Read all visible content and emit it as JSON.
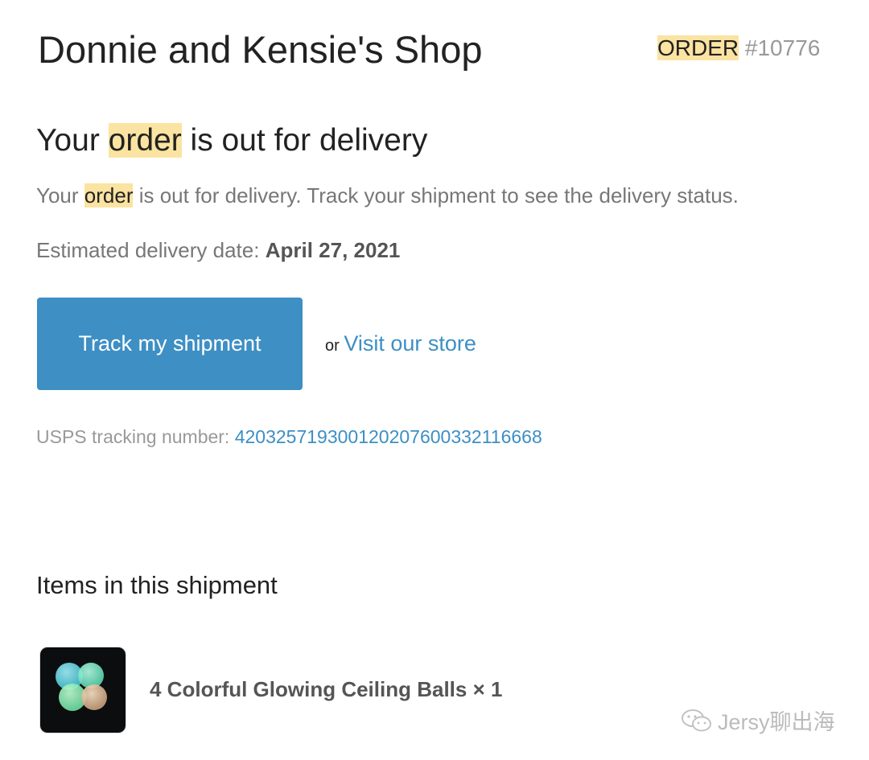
{
  "header": {
    "shop_name": "Donnie and Kensie's Shop",
    "order_word": "ORDER",
    "order_number": "#10776"
  },
  "status": {
    "heading_prefix": "Your",
    "heading_highlight": "order",
    "heading_suffix": "is out for delivery",
    "body_prefix": "Your",
    "body_highlight": "order",
    "body_suffix": "is out for delivery. Track your shipment to see the delivery status.",
    "estimated_label": "Estimated delivery date:",
    "estimated_date": "April 27, 2021"
  },
  "actions": {
    "track_button": "Track my shipment",
    "or_text": "or",
    "visit_store_link": "Visit our store"
  },
  "tracking": {
    "label": "USPS tracking number:",
    "number": "420325719300120207600332116668"
  },
  "items": {
    "heading": "Items in this shipment",
    "list": [
      {
        "name": "4 Colorful Glowing Ceiling Balls × 1"
      }
    ]
  },
  "watermark": {
    "text": "Jersy聊出海"
  },
  "colors": {
    "accent": "#3d8fc4",
    "highlight": "#fbe3a1",
    "heading_text": "#222222",
    "body_text": "#777777"
  }
}
